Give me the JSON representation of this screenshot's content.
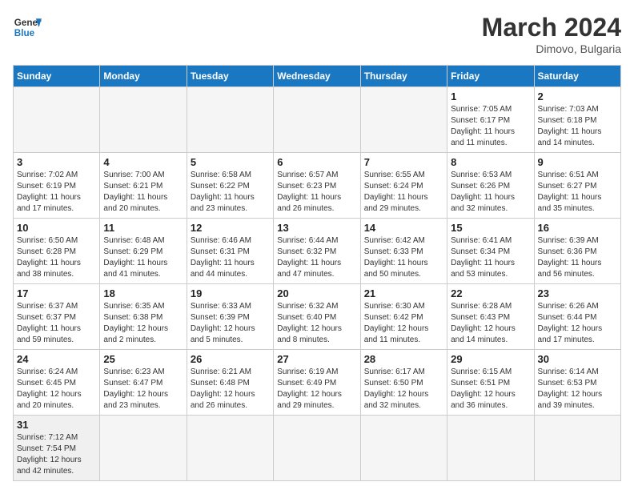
{
  "header": {
    "logo_general": "General",
    "logo_blue": "Blue",
    "title": "March 2024",
    "location": "Dimovo, Bulgaria"
  },
  "weekdays": [
    "Sunday",
    "Monday",
    "Tuesday",
    "Wednesday",
    "Thursday",
    "Friday",
    "Saturday"
  ],
  "weeks": [
    [
      {
        "day": "",
        "info": ""
      },
      {
        "day": "",
        "info": ""
      },
      {
        "day": "",
        "info": ""
      },
      {
        "day": "",
        "info": ""
      },
      {
        "day": "",
        "info": ""
      },
      {
        "day": "1",
        "info": "Sunrise: 7:05 AM\nSunset: 6:17 PM\nDaylight: 11 hours\nand 11 minutes."
      },
      {
        "day": "2",
        "info": "Sunrise: 7:03 AM\nSunset: 6:18 PM\nDaylight: 11 hours\nand 14 minutes."
      }
    ],
    [
      {
        "day": "3",
        "info": "Sunrise: 7:02 AM\nSunset: 6:19 PM\nDaylight: 11 hours\nand 17 minutes."
      },
      {
        "day": "4",
        "info": "Sunrise: 7:00 AM\nSunset: 6:21 PM\nDaylight: 11 hours\nand 20 minutes."
      },
      {
        "day": "5",
        "info": "Sunrise: 6:58 AM\nSunset: 6:22 PM\nDaylight: 11 hours\nand 23 minutes."
      },
      {
        "day": "6",
        "info": "Sunrise: 6:57 AM\nSunset: 6:23 PM\nDaylight: 11 hours\nand 26 minutes."
      },
      {
        "day": "7",
        "info": "Sunrise: 6:55 AM\nSunset: 6:24 PM\nDaylight: 11 hours\nand 29 minutes."
      },
      {
        "day": "8",
        "info": "Sunrise: 6:53 AM\nSunset: 6:26 PM\nDaylight: 11 hours\nand 32 minutes."
      },
      {
        "day": "9",
        "info": "Sunrise: 6:51 AM\nSunset: 6:27 PM\nDaylight: 11 hours\nand 35 minutes."
      }
    ],
    [
      {
        "day": "10",
        "info": "Sunrise: 6:50 AM\nSunset: 6:28 PM\nDaylight: 11 hours\nand 38 minutes."
      },
      {
        "day": "11",
        "info": "Sunrise: 6:48 AM\nSunset: 6:29 PM\nDaylight: 11 hours\nand 41 minutes."
      },
      {
        "day": "12",
        "info": "Sunrise: 6:46 AM\nSunset: 6:31 PM\nDaylight: 11 hours\nand 44 minutes."
      },
      {
        "day": "13",
        "info": "Sunrise: 6:44 AM\nSunset: 6:32 PM\nDaylight: 11 hours\nand 47 minutes."
      },
      {
        "day": "14",
        "info": "Sunrise: 6:42 AM\nSunset: 6:33 PM\nDaylight: 11 hours\nand 50 minutes."
      },
      {
        "day": "15",
        "info": "Sunrise: 6:41 AM\nSunset: 6:34 PM\nDaylight: 11 hours\nand 53 minutes."
      },
      {
        "day": "16",
        "info": "Sunrise: 6:39 AM\nSunset: 6:36 PM\nDaylight: 11 hours\nand 56 minutes."
      }
    ],
    [
      {
        "day": "17",
        "info": "Sunrise: 6:37 AM\nSunset: 6:37 PM\nDaylight: 11 hours\nand 59 minutes."
      },
      {
        "day": "18",
        "info": "Sunrise: 6:35 AM\nSunset: 6:38 PM\nDaylight: 12 hours\nand 2 minutes."
      },
      {
        "day": "19",
        "info": "Sunrise: 6:33 AM\nSunset: 6:39 PM\nDaylight: 12 hours\nand 5 minutes."
      },
      {
        "day": "20",
        "info": "Sunrise: 6:32 AM\nSunset: 6:40 PM\nDaylight: 12 hours\nand 8 minutes."
      },
      {
        "day": "21",
        "info": "Sunrise: 6:30 AM\nSunset: 6:42 PM\nDaylight: 12 hours\nand 11 minutes."
      },
      {
        "day": "22",
        "info": "Sunrise: 6:28 AM\nSunset: 6:43 PM\nDaylight: 12 hours\nand 14 minutes."
      },
      {
        "day": "23",
        "info": "Sunrise: 6:26 AM\nSunset: 6:44 PM\nDaylight: 12 hours\nand 17 minutes."
      }
    ],
    [
      {
        "day": "24",
        "info": "Sunrise: 6:24 AM\nSunset: 6:45 PM\nDaylight: 12 hours\nand 20 minutes."
      },
      {
        "day": "25",
        "info": "Sunrise: 6:23 AM\nSunset: 6:47 PM\nDaylight: 12 hours\nand 23 minutes."
      },
      {
        "day": "26",
        "info": "Sunrise: 6:21 AM\nSunset: 6:48 PM\nDaylight: 12 hours\nand 26 minutes."
      },
      {
        "day": "27",
        "info": "Sunrise: 6:19 AM\nSunset: 6:49 PM\nDaylight: 12 hours\nand 29 minutes."
      },
      {
        "day": "28",
        "info": "Sunrise: 6:17 AM\nSunset: 6:50 PM\nDaylight: 12 hours\nand 32 minutes."
      },
      {
        "day": "29",
        "info": "Sunrise: 6:15 AM\nSunset: 6:51 PM\nDaylight: 12 hours\nand 36 minutes."
      },
      {
        "day": "30",
        "info": "Sunrise: 6:14 AM\nSunset: 6:53 PM\nDaylight: 12 hours\nand 39 minutes."
      }
    ],
    [
      {
        "day": "31",
        "info": "Sunrise: 7:12 AM\nSunset: 7:54 PM\nDaylight: 12 hours\nand 42 minutes."
      },
      {
        "day": "",
        "info": ""
      },
      {
        "day": "",
        "info": ""
      },
      {
        "day": "",
        "info": ""
      },
      {
        "day": "",
        "info": ""
      },
      {
        "day": "",
        "info": ""
      },
      {
        "day": "",
        "info": ""
      }
    ]
  ]
}
